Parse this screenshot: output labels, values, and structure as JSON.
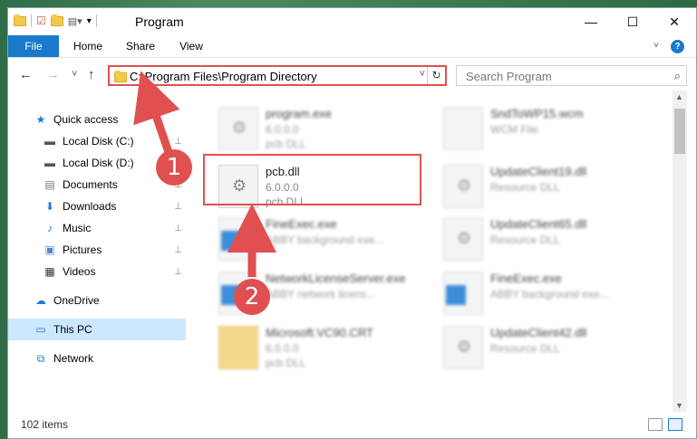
{
  "window": {
    "title": "Program",
    "min_glyph": "—",
    "max_glyph": "☐",
    "close_glyph": "✕"
  },
  "ribbon": {
    "tabs": [
      "File",
      "Home",
      "Share",
      "View"
    ],
    "help": "?"
  },
  "nav": {
    "back": "←",
    "forward": "→",
    "recent": "˅",
    "up": "↑",
    "address": "C:\\Program Files\\Program Directory",
    "address_dropdown": "˅",
    "refresh": "↻",
    "search_placeholder": "Search Program",
    "search_icon": "⌕"
  },
  "sidebar": {
    "items": [
      {
        "label": "Quick access",
        "icon": "star-icon",
        "glyph": "★",
        "color": "#1e7ad4"
      },
      {
        "label": "Local Disk (C:)",
        "icon": "drive-icon",
        "glyph": "▬",
        "color": "#555"
      },
      {
        "label": "Local Disk (D:)",
        "icon": "drive-icon",
        "glyph": "▬",
        "color": "#555"
      },
      {
        "label": "Documents",
        "icon": "documents-icon",
        "glyph": "▤",
        "color": "#777"
      },
      {
        "label": "Downloads",
        "icon": "download-icon",
        "glyph": "⬇",
        "color": "#1e7ad4"
      },
      {
        "label": "Music",
        "icon": "music-icon",
        "glyph": "♪",
        "color": "#1e7ad4"
      },
      {
        "label": "Pictures",
        "icon": "pictures-icon",
        "glyph": "▣",
        "color": "#4a8ac9"
      },
      {
        "label": "Videos",
        "icon": "videos-icon",
        "glyph": "▦",
        "color": "#333"
      },
      {
        "label": "OneDrive",
        "icon": "cloud-icon",
        "glyph": "☁",
        "color": "#1e7ad4"
      },
      {
        "label": "This PC",
        "icon": "computer-icon",
        "glyph": "▭",
        "color": "#1e7ad4"
      },
      {
        "label": "Network",
        "icon": "network-icon",
        "glyph": "⧉",
        "color": "#1e7ad4"
      }
    ],
    "pin_glyph": "📌"
  },
  "files": [
    {
      "name": "program.exe",
      "line2": "6.0.0.0",
      "line3": "pcb DLL",
      "icon": "exe-icon",
      "blur": true
    },
    {
      "name": "SndToWP15.wcm",
      "line2": "WCM File",
      "line3": "",
      "icon": "file-icon",
      "blur": true
    },
    {
      "name": "pcb.dll",
      "line2": "6.0.0.0",
      "line3": "pcb DLL",
      "icon": "dll-icon",
      "blur": false
    },
    {
      "name": "UpdateClient19.dll",
      "line2": "Resource DLL",
      "line3": "",
      "icon": "dll-icon",
      "blur": true
    },
    {
      "name": "FineExec.exe",
      "line2": "ABBY background exe...",
      "line3": "",
      "icon": "exe-icon",
      "blur": true
    },
    {
      "name": "UpdateClient65.dll",
      "line2": "Resource DLL",
      "line3": "",
      "icon": "dll-icon",
      "blur": true
    },
    {
      "name": "NetworkLicenseServer.exe",
      "line2": "ABBY network licens...",
      "line3": "",
      "icon": "exe-icon",
      "blur": true
    },
    {
      "name": "FineExec.exe",
      "line2": "ABBY background exe...",
      "line3": "",
      "icon": "exe-icon",
      "blur": true
    },
    {
      "name": "Microsoft.VC90.CRT",
      "line2": "6.0.0.0",
      "line3": "pcb DLL",
      "icon": "folder-icon",
      "blur": true
    },
    {
      "name": "UpdateClient42.dll",
      "line2": "Resource DLL",
      "line3": "",
      "icon": "dll-icon",
      "blur": true
    }
  ],
  "status": {
    "count": "102 items"
  },
  "annotations": {
    "badge1": "1",
    "badge2": "2",
    "color": "#e05050"
  }
}
